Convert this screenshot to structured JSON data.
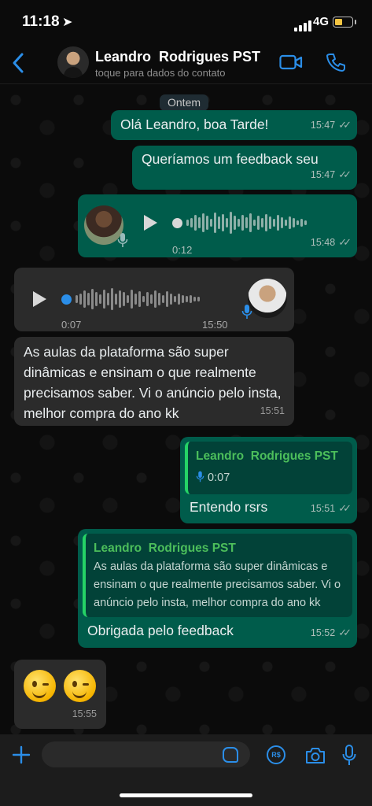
{
  "status_bar": {
    "time": "11:18",
    "network": "4G"
  },
  "header": {
    "name": "Leandro  Rodrigues PST",
    "subtitle": "toque para dados do contato"
  },
  "chat": {
    "day_label": "Ontem",
    "messages": [
      {
        "text": "Olá Leandro, boa Tarde!",
        "time": "15:47"
      },
      {
        "text": "Queríamos um feedback seu",
        "time": "15:47"
      },
      {
        "duration": "0:12",
        "time": "15:48"
      },
      {
        "duration": "0:07",
        "time": "15:50"
      },
      {
        "text": "As aulas da plataforma são super dinâmicas e ensinam o que realmente precisamos saber. Vi o anúncio pelo insta, melhor compra do ano kk",
        "time": "15:51"
      },
      {
        "quote_name": "Leandro  Rodrigues PST",
        "quote_audio": "0:07",
        "text": "Entendo rsrs",
        "time": "15:51"
      },
      {
        "quote_name": "Leandro  Rodrigues PST",
        "quote_text": "As aulas da plataforma são super dinâmicas e ensinam o que realmente precisamos saber. Vi o anúncio pelo insta, melhor compra do ano kk",
        "text": "Obrigada pelo feedback",
        "time": "15:52"
      },
      {
        "emoji": "😉😉",
        "time": "15:55"
      }
    ]
  },
  "input": {
    "placeholder": ""
  },
  "colors": {
    "outgoing": "#005c4b",
    "incoming": "#2b2b2b",
    "accent": "#2b8ee8",
    "quote_name": "#4cbe5b"
  },
  "icons": [
    "location-arrow-icon",
    "signal-icon",
    "battery-icon",
    "back-chevron-icon",
    "video-call-icon",
    "phone-call-icon",
    "play-icon",
    "mic-icon",
    "double-check-icon",
    "plus-icon",
    "sticker-icon",
    "pix-icon",
    "camera-icon"
  ]
}
